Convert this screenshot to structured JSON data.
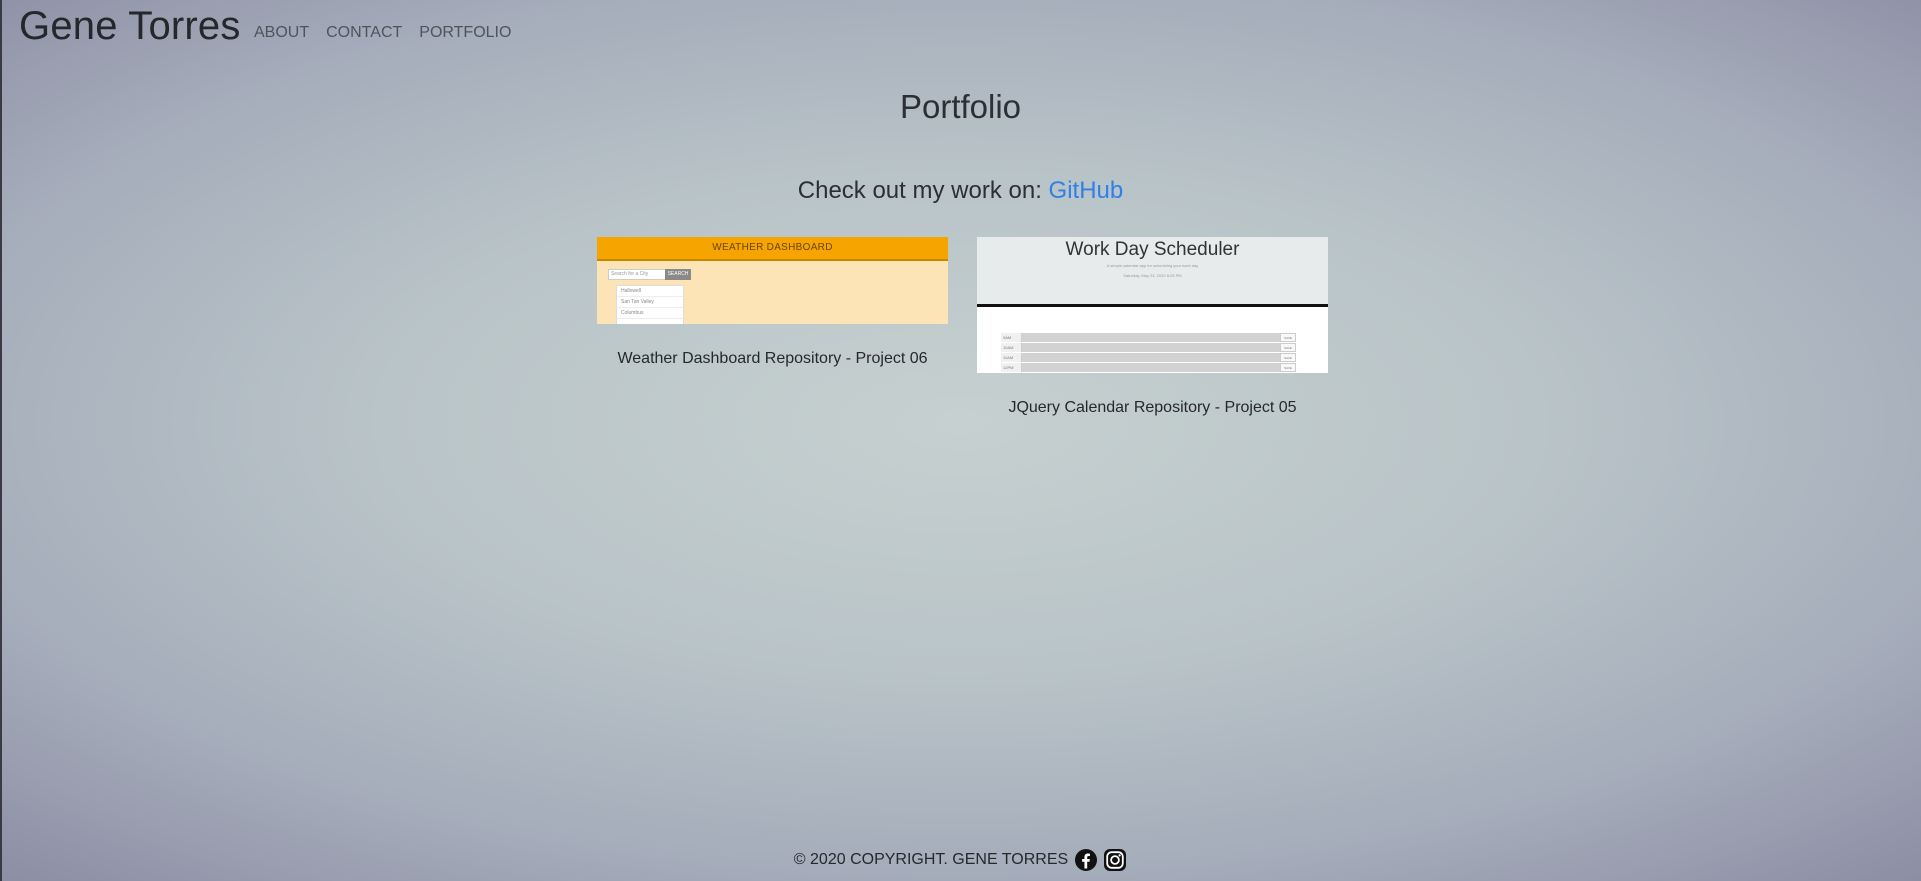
{
  "header": {
    "brand": "Gene Torres",
    "nav": [
      {
        "label": "ABOUT"
      },
      {
        "label": "CONTACT"
      },
      {
        "label": "PORTFOLIO"
      }
    ]
  },
  "main": {
    "title": "Portfolio",
    "subtitle_prefix": "Check out my work on: ",
    "subtitle_link": "GitHub",
    "projects": [
      {
        "caption": "Weather Dashboard Repository - Project 06",
        "thumb": {
          "heading": "WEATHER DASHBOARD",
          "search_placeholder": "Search for a City",
          "search_button": "SEARCH",
          "cities": [
            "Hallowell",
            "San Tan Valley",
            "Columbus"
          ]
        }
      },
      {
        "caption": "JQuery Calendar Repository - Project 05",
        "thumb": {
          "heading": "Work Day Scheduler",
          "subheading": "A simple calendar app for scheduling your work day",
          "date": "Saturday, May 23, 2020 8:25 PM",
          "hours": [
            "9AM",
            "10AM",
            "11AM",
            "12PM"
          ],
          "save_label": "SAVE"
        }
      }
    ]
  },
  "footer": {
    "copyright": "© 2020 COPYRIGHT. GENE TORRES"
  },
  "colors": {
    "link": "#2f80e8",
    "weather_header": "#f6a400",
    "weather_body": "#fde4b6"
  },
  "icons": [
    "facebook-icon",
    "instagram-icon"
  ]
}
